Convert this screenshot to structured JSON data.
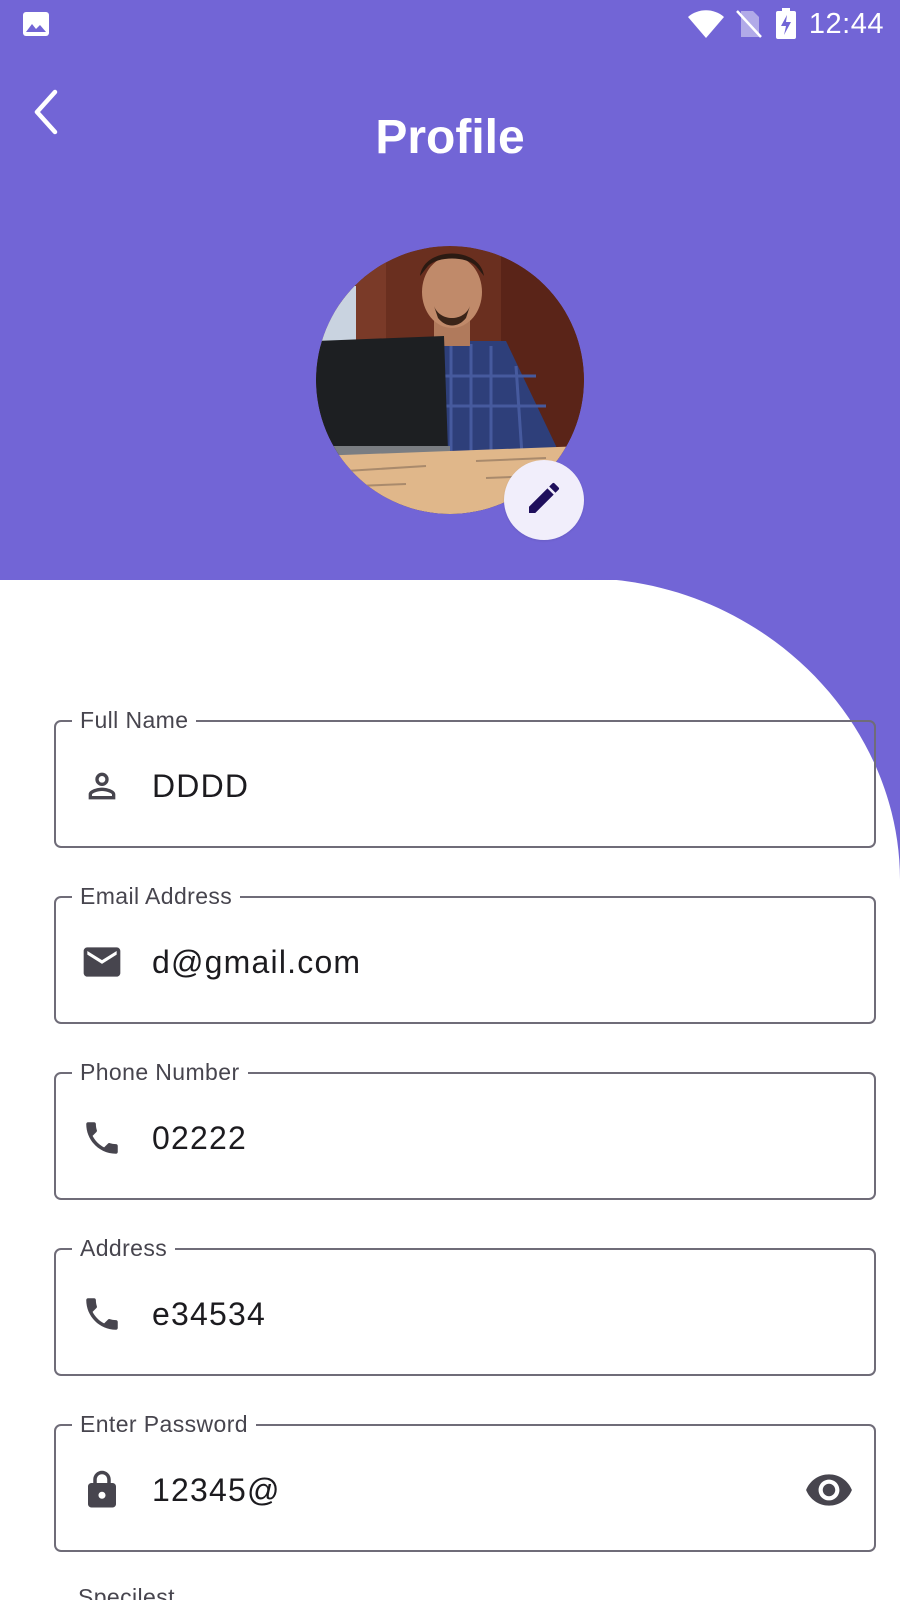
{
  "status_bar": {
    "time": "12:44",
    "left_icon": "image-icon",
    "icons": [
      "wifi-icon",
      "no-sim-icon",
      "battery-charging-icon"
    ]
  },
  "header": {
    "title": "Profile",
    "back_icon": "chevron-left-icon",
    "edit_icon": "pencil-icon"
  },
  "colors": {
    "primary": "#7265d6",
    "field_border": "#6f6c78",
    "text": "#1c1b1f",
    "label": "#47454e",
    "icon": "#47454e",
    "edit_bg": "#f1eefb",
    "edit_icon": "#1f0f5c"
  },
  "form": {
    "fields": [
      {
        "label": "Full Name",
        "value": "DDDD",
        "icon": "person-icon"
      },
      {
        "label": "Email Address",
        "value": "d@gmail.com",
        "icon": "mail-icon"
      },
      {
        "label": "Phone Number",
        "value": "02222",
        "icon": "phone-icon"
      },
      {
        "label": "Address",
        "value": "e34534",
        "icon": "phone-icon"
      },
      {
        "label": "Enter Password",
        "value": "12345@",
        "icon": "lock-icon",
        "trailing_icon": "eye-icon"
      }
    ],
    "next_label": "Specilest"
  }
}
